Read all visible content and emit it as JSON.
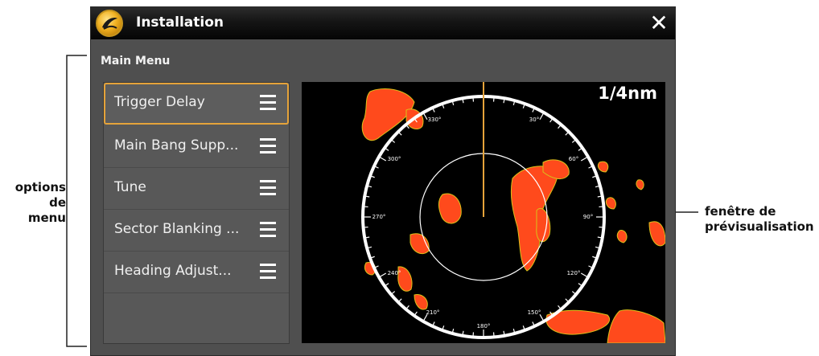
{
  "window": {
    "title": "Installation",
    "close_symbol": "✕",
    "logo_icon": "humminbird-logo-icon"
  },
  "main_menu": {
    "title": "Main Menu",
    "items": [
      {
        "label": "Trigger Delay",
        "selected": true,
        "icon": "menu-lines-icon"
      },
      {
        "label": "Main Bang Supp...",
        "selected": false,
        "icon": "menu-lines-icon"
      },
      {
        "label": "Tune",
        "selected": false,
        "icon": "menu-lines-icon"
      },
      {
        "label": "Sector Blanking ...",
        "selected": false,
        "icon": "menu-lines-icon"
      },
      {
        "label": "Heading Adjust...",
        "selected": false,
        "icon": "menu-lines-icon"
      }
    ]
  },
  "preview": {
    "range": "1/4nm",
    "bearings": [
      "330°",
      "30°",
      "300°",
      "60°",
      "270°",
      "90°",
      "240°",
      "120°",
      "210°",
      "150°",
      "180°"
    ]
  },
  "annotations": {
    "left_line1": "options",
    "left_line2": "de menu",
    "right_line1": "fenêtre de",
    "right_line2": "prévisualisation"
  },
  "colors": {
    "accent": "#e5a33a",
    "echo": "#ff4a1c",
    "window_bg": "#4f4f4f"
  }
}
